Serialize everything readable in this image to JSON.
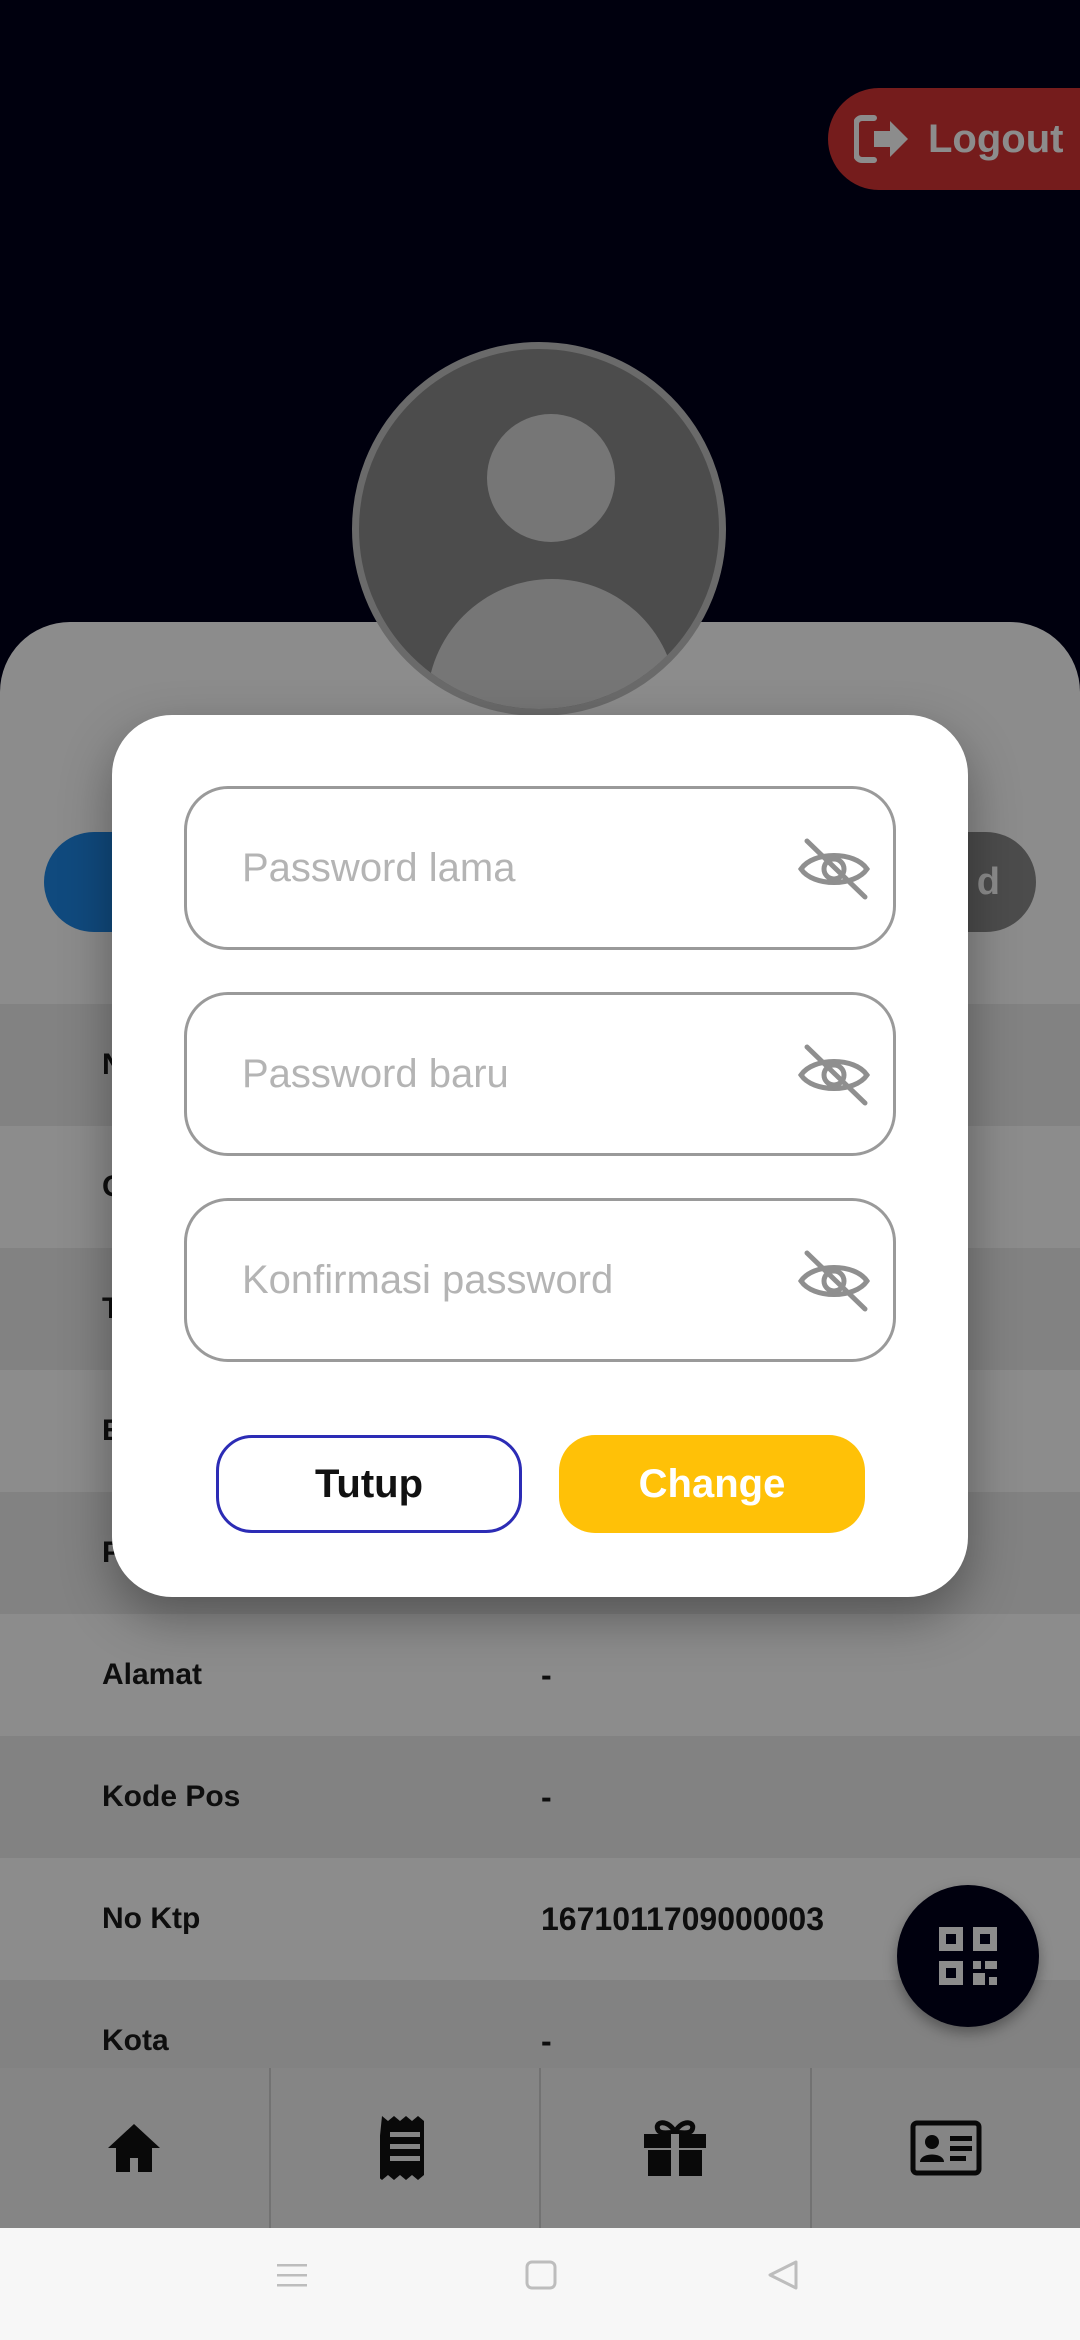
{
  "header": {
    "logout_label": "Logout"
  },
  "profile": {
    "right_pill_text": "d"
  },
  "info_rows": [
    {
      "key": "N",
      "value": ""
    },
    {
      "key": "G",
      "value": ""
    },
    {
      "key": "T",
      "value": ""
    },
    {
      "key": "E",
      "value": ""
    },
    {
      "key": "P",
      "value": ""
    },
    {
      "key": "Alamat",
      "value": "-"
    },
    {
      "key": "Kode Pos",
      "value": "-"
    },
    {
      "key": "No Ktp",
      "value": "1671011709000003"
    },
    {
      "key": "Kota",
      "value": "-"
    }
  ],
  "dialog": {
    "old_password_placeholder": "Password lama",
    "new_password_placeholder": "Password baru",
    "confirm_password_placeholder": "Konfirmasi password",
    "close_label": "Tutup",
    "change_label": "Change"
  },
  "bottom_nav": [
    "home-icon",
    "receipt-icon",
    "gift-icon",
    "id-card-icon"
  ],
  "colors": {
    "header_bg": "#00001a",
    "logout_bg": "#d63434",
    "change_bg": "#ffc107",
    "tutup_border": "#2c2cb5",
    "blue_pill": "#1e88e5"
  }
}
